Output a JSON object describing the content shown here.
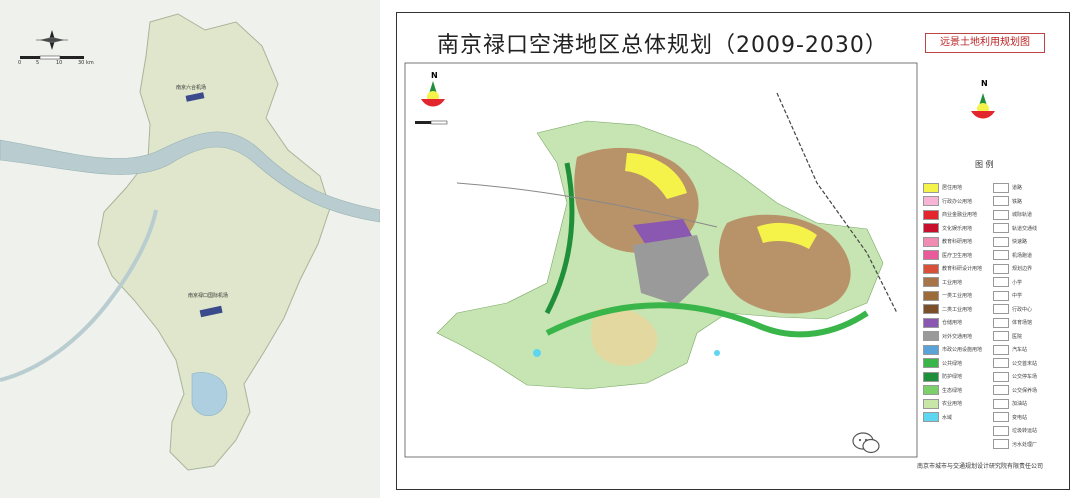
{
  "left_map": {
    "airport_labels": [
      "南京六合机场",
      "南京禄口国际机场"
    ],
    "scale_labels": [
      "0",
      "5",
      "10",
      "30 km"
    ]
  },
  "right_map": {
    "title": "南京禄口空港地区总体规划（2009-2030）",
    "subtitle": "远景土地利用规划图",
    "compass": "N",
    "legend_heading": "图  例",
    "credit": "南京市城市与交通规划设计研究院有限责任公司",
    "legend": [
      {
        "label": "居住用地",
        "color": "#f5f24a"
      },
      {
        "label": "行政办公用地",
        "color": "#f7b4d4"
      },
      {
        "label": "商业金融业用地",
        "color": "#e3262e"
      },
      {
        "label": "文化娱乐用地",
        "color": "#c8102e"
      },
      {
        "label": "教育科研用地",
        "color": "#f08cb4"
      },
      {
        "label": "医疗卫生用地",
        "color": "#ea5a9a"
      },
      {
        "label": "教育科研设计用地",
        "color": "#d8503a"
      },
      {
        "label": "工业用地",
        "color": "#a8744a"
      },
      {
        "label": "一类工业用地",
        "color": "#9b6b3a"
      },
      {
        "label": "二类工业用地",
        "color": "#7a4f2a"
      },
      {
        "label": "仓储用地",
        "color": "#8a58b0"
      },
      {
        "label": "对外交通用地",
        "color": "#9a9a9a"
      },
      {
        "label": "市政公用设施用地",
        "color": "#5aa3d8"
      },
      {
        "label": "公共绿地",
        "color": "#39b54a"
      },
      {
        "label": "防护绿地",
        "color": "#1f8f3a"
      },
      {
        "label": "生态绿地",
        "color": "#7ccf6a"
      },
      {
        "label": "农业用地",
        "color": "#c8e6a8"
      },
      {
        "label": "水域",
        "color": "#5fd6f0"
      }
    ],
    "legend_symbols": [
      "道路",
      "铁路",
      "城际轨道",
      "轨道交通线",
      "快速路",
      "机场跑道",
      "规划边界",
      "小学",
      "中学",
      "行政中心",
      "体育场馆",
      "医院",
      "汽车站",
      "公交首末站",
      "公交停车场",
      "公交保养场",
      "加油站",
      "变电站",
      "垃圾转运站",
      "污水处理厂",
      "给水厂"
    ]
  }
}
